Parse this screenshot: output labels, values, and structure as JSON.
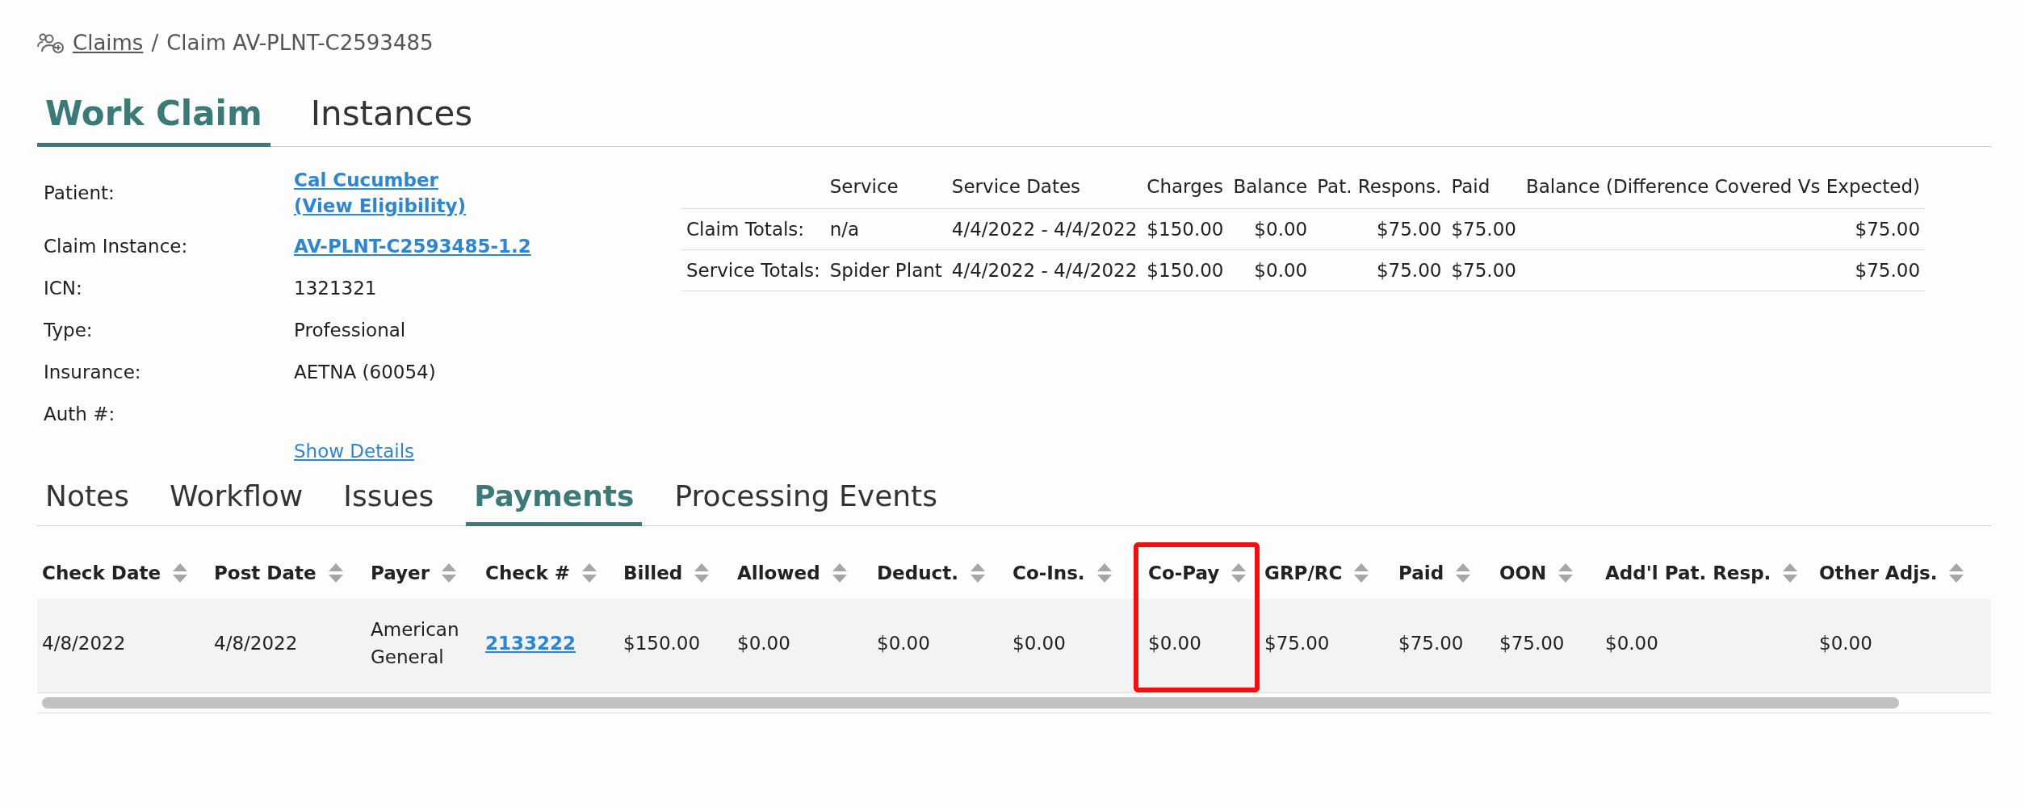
{
  "breadcrumb": {
    "link": "Claims",
    "separator": "/",
    "current": "Claim AV-PLNT-C2593485"
  },
  "tabs": [
    {
      "label": "Work Claim",
      "selected": true
    },
    {
      "label": "Instances",
      "selected": false
    }
  ],
  "claim_info": [
    {
      "label": "Patient:",
      "kind": "links",
      "values": [
        "Cal Cucumber",
        "(View Eligibility)"
      ]
    },
    {
      "label": "Claim Instance:",
      "kind": "links",
      "values": [
        "AV-PLNT-C2593485-1.2"
      ]
    },
    {
      "label": "ICN:",
      "kind": "text",
      "values": [
        "1321321"
      ]
    },
    {
      "label": "Type:",
      "kind": "text",
      "values": [
        "Professional"
      ]
    },
    {
      "label": "Insurance:",
      "kind": "text",
      "values": [
        "AETNA (60054)"
      ]
    },
    {
      "label": "Auth #:"
    }
  ],
  "show_details": "Show Details",
  "totals_table": {
    "columns": [
      "Service",
      "Service Dates",
      "Charges",
      "Balance",
      "Pat. Respons.",
      "Paid",
      "Balance (Difference Covered Vs Expected)"
    ],
    "rows": [
      {
        "label": "Claim Totals:",
        "cells": [
          "n/a",
          "4/4/2022 - 4/4/2022",
          "$150.00",
          "$0.00",
          "$75.00",
          "$75.00",
          "$75.00"
        ]
      },
      {
        "label": "Service Totals:",
        "cells": [
          "Spider Plant",
          "4/4/2022 - 4/4/2022",
          "$150.00",
          "$0.00",
          "$75.00",
          "$75.00",
          "$75.00"
        ]
      }
    ]
  },
  "sub_tabs": [
    {
      "label": "Notes",
      "selected": false
    },
    {
      "label": "Workflow",
      "selected": false
    },
    {
      "label": "Issues",
      "selected": false
    },
    {
      "label": "Payments",
      "selected": true
    },
    {
      "label": "Processing Events",
      "selected": false
    }
  ],
  "payments_table": {
    "columns": [
      {
        "label": "Check Date",
        "highlighted": false
      },
      {
        "label": "Post Date",
        "highlighted": false
      },
      {
        "label": "Payer",
        "highlighted": false
      },
      {
        "label": "Check #",
        "highlighted": false
      },
      {
        "label": "Billed",
        "highlighted": false
      },
      {
        "label": "Allowed",
        "highlighted": false
      },
      {
        "label": "Deduct.",
        "highlighted": false
      },
      {
        "label": "Co-Ins.",
        "highlighted": false
      },
      {
        "label": "Co-Pay",
        "highlighted": true
      },
      {
        "label": "GRP/RC",
        "highlighted": false
      },
      {
        "label": "Paid",
        "highlighted": false
      },
      {
        "label": "OON",
        "highlighted": false
      },
      {
        "label": "Add'l Pat. Resp.",
        "highlighted": false
      },
      {
        "label": "Other Adjs.",
        "highlighted": false
      }
    ],
    "rows": [
      {
        "cells": [
          {
            "text": "4/8/2022",
            "kind": "text"
          },
          {
            "text": "4/8/2022",
            "kind": "text"
          },
          {
            "text": "American General",
            "kind": "text"
          },
          {
            "text": "2133222",
            "kind": "link"
          },
          {
            "text": "$150.00",
            "kind": "text"
          },
          {
            "text": "$0.00",
            "kind": "text"
          },
          {
            "text": "$0.00",
            "kind": "text"
          },
          {
            "text": "$0.00",
            "kind": "text"
          },
          {
            "text": "$0.00",
            "kind": "text"
          },
          {
            "text": "$75.00",
            "kind": "text"
          },
          {
            "text": "$75.00",
            "kind": "text"
          },
          {
            "text": "$75.00",
            "kind": "text"
          },
          {
            "text": "$0.00",
            "kind": "text"
          },
          {
            "text": "$0.00",
            "kind": "text"
          }
        ]
      }
    ]
  }
}
